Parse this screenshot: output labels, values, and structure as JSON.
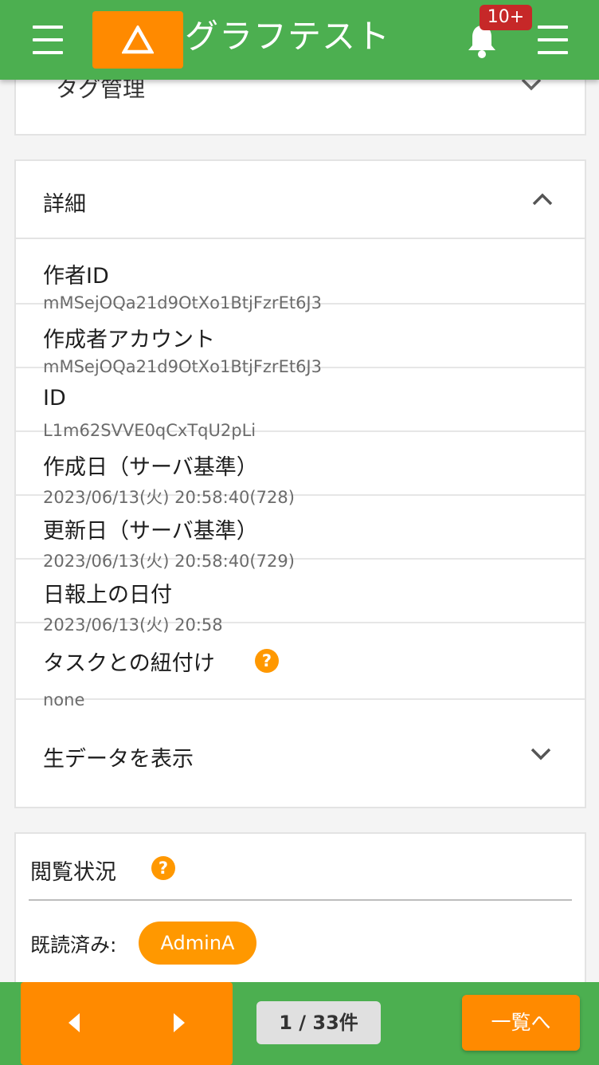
{
  "header": {
    "app_title": "グラフテスト",
    "notification_count": "10+"
  },
  "tags_section": {
    "title": "タグ管理"
  },
  "detail_section": {
    "title": "詳細",
    "fields": [
      {
        "label": "作者ID",
        "value": "mMSejOQa21d9OtXo1BtjFzrEt6J3"
      },
      {
        "label": "作成者アカウント",
        "value": "mMSejOQa21d9OtXo1BtjFzrEt6J3"
      },
      {
        "label": "ID",
        "value": "L1m62SVVE0qCxTqU2pLi"
      },
      {
        "label": "作成日（サーバ基準）",
        "value": "2023/06/13(火) 20:58:40(728)"
      },
      {
        "label": "更新日（サーバ基準）",
        "value": "2023/06/13(火) 20:58:40(729)"
      },
      {
        "label": "日報上の日付",
        "value": "2023/06/13(火) 20:58"
      },
      {
        "label": "タスクとの紐付け",
        "value": "none",
        "help": "?"
      }
    ],
    "raw_data_label": "生データを表示"
  },
  "views_section": {
    "title": "閲覧状況",
    "help": "?",
    "read_label": "既読済み:",
    "readers": [
      "AdminA"
    ]
  },
  "footer": {
    "page_count": "1 / 33件",
    "list_button": "一覧へ"
  },
  "colors": {
    "header_green": "#4caf50",
    "accent_orange": "#ff8a00",
    "badge_red": "#c62828"
  }
}
